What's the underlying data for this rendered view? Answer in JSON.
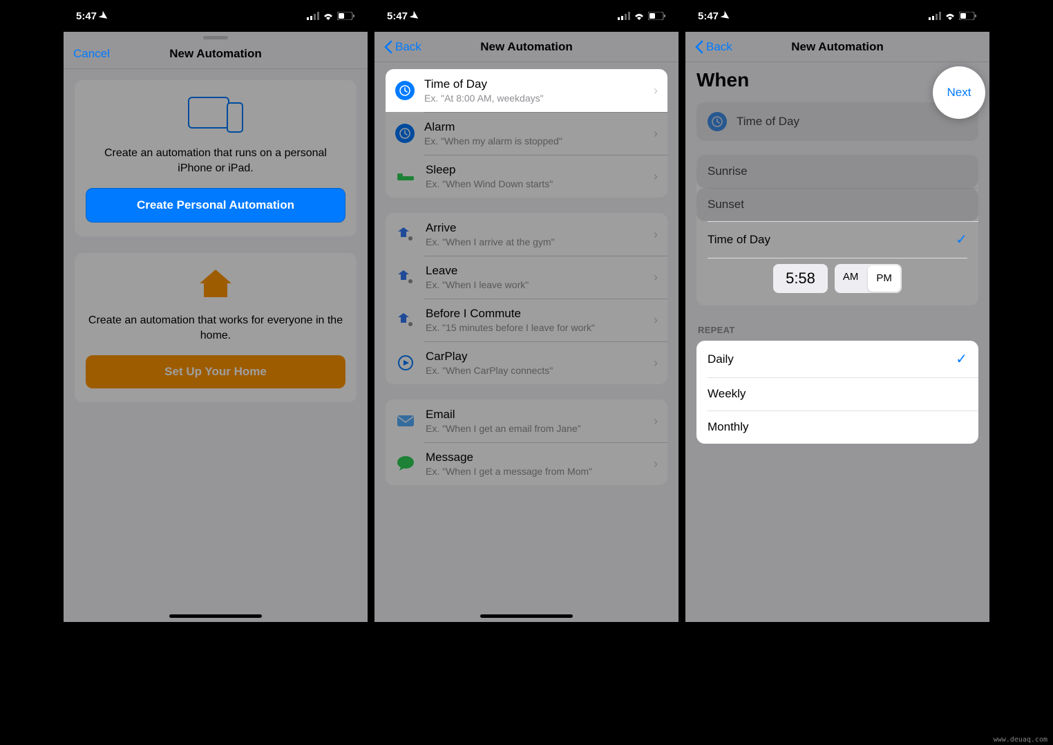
{
  "status": {
    "time": "5:47",
    "location_arrow": "➤"
  },
  "screen1": {
    "nav": {
      "cancel": "Cancel",
      "title": "New Automation"
    },
    "personal": {
      "description": "Create an automation that runs on a personal iPhone or iPad.",
      "button": "Create Personal Automation"
    },
    "home": {
      "description": "Create an automation that works for everyone in the home.",
      "button": "Set Up Your Home"
    }
  },
  "screen2": {
    "nav": {
      "back": "Back",
      "title": "New Automation"
    },
    "triggers": {
      "time": [
        {
          "title": "Time of Day",
          "sub": "Ex. \"At 8:00 AM, weekdays\"",
          "icon": "clock"
        },
        {
          "title": "Alarm",
          "sub": "Ex. \"When my alarm is stopped\"",
          "icon": "clock"
        },
        {
          "title": "Sleep",
          "sub": "Ex. \"When Wind Down starts\"",
          "icon": "bed"
        }
      ],
      "location": [
        {
          "title": "Arrive",
          "sub": "Ex. \"When I arrive at the gym\"",
          "icon": "arrive"
        },
        {
          "title": "Leave",
          "sub": "Ex. \"When I leave work\"",
          "icon": "leave"
        },
        {
          "title": "Before I Commute",
          "sub": "Ex. \"15 minutes before I leave for work\"",
          "icon": "arrive"
        },
        {
          "title": "CarPlay",
          "sub": "Ex. \"When CarPlay connects\"",
          "icon": "carplay"
        }
      ],
      "comm": [
        {
          "title": "Email",
          "sub": "Ex. \"When I get an email from Jane\"",
          "icon": "email"
        },
        {
          "title": "Message",
          "sub": "Ex. \"When I get a message from Mom\"",
          "icon": "message"
        }
      ]
    }
  },
  "screen3": {
    "nav": {
      "back": "Back",
      "title": "New Automation",
      "next": "Next"
    },
    "heading": "When",
    "selected_trigger": "Time of Day",
    "time_options": {
      "sunrise": "Sunrise",
      "sunset": "Sunset",
      "time_of_day": "Time of Day"
    },
    "time_value": "5:58",
    "am": "AM",
    "pm": "PM",
    "selected_meridiem": "PM",
    "repeat_header": "Repeat",
    "repeat_options": {
      "daily": "Daily",
      "weekly": "Weekly",
      "monthly": "Monthly"
    },
    "selected_repeat": "Daily"
  }
}
